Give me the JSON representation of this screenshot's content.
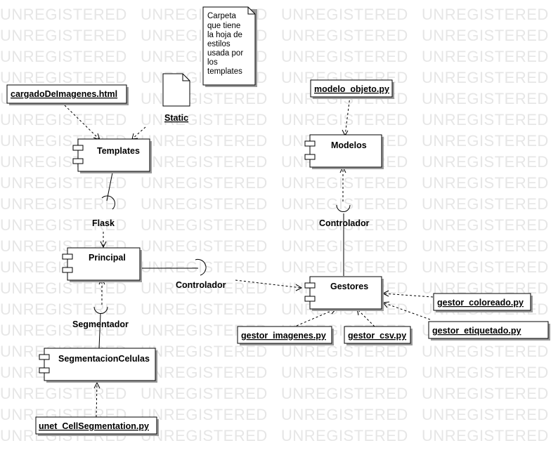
{
  "watermark": "UNREGISTERED",
  "components": {
    "templates": "Templates",
    "principal": "Principal",
    "segmentacion": "SegmentacionCelulas",
    "modelos": "Modelos",
    "gestores": "Gestores"
  },
  "artifacts": {
    "cargado": "cargadoDeImagenes.html",
    "static": "Static",
    "modelo_objeto": "modelo_objeto.py",
    "gestor_imagenes": "gestor_imagenes.py",
    "gestor_csv": "gestor_csv.py",
    "gestor_coloreado": "gestor_coloreado.py",
    "gestor_etiquetado": "gestor_etiquetado.py",
    "unet": "unet_CellSegmentation.py"
  },
  "interfaces": {
    "flask": "Flask",
    "controlador_left": "Controlador",
    "controlador_top": "Controlador",
    "segmentador": "Segmentador"
  },
  "note": {
    "lines": [
      "Carpeta",
      "que tiene",
      "la hoja de",
      "estilos",
      "usada por",
      "los",
      "templates"
    ]
  }
}
